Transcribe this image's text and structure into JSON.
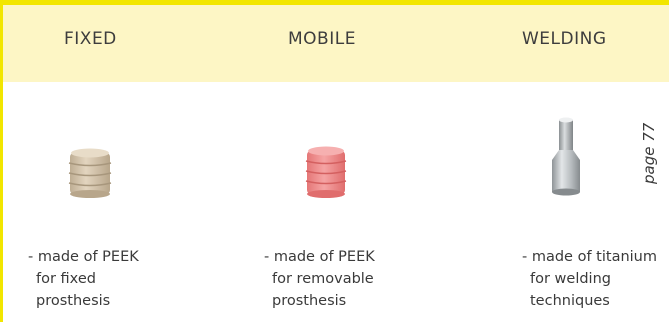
{
  "columns": [
    {
      "heading": "FIXED",
      "desc": [
        "- made of PEEK",
        "for fixed",
        "prosthesis"
      ],
      "product_icon": "peek-disc-stack-beige",
      "product_color": "#d9c9b0"
    },
    {
      "heading": "MOBILE",
      "desc": [
        "- made of PEEK",
        "for removable",
        "prosthesis"
      ],
      "product_icon": "peek-disc-stack-pink",
      "product_color": "#ef8f8f"
    },
    {
      "heading": "WELDING",
      "desc": [
        "- made of titanium",
        "for welding",
        "techniques"
      ],
      "product_icon": "titanium-cylinder",
      "product_color": "#b9bdc0"
    }
  ],
  "page_reference": "page 77",
  "colors": {
    "accent_yellow": "#f2e600",
    "header_band": "#fdf6c5"
  }
}
